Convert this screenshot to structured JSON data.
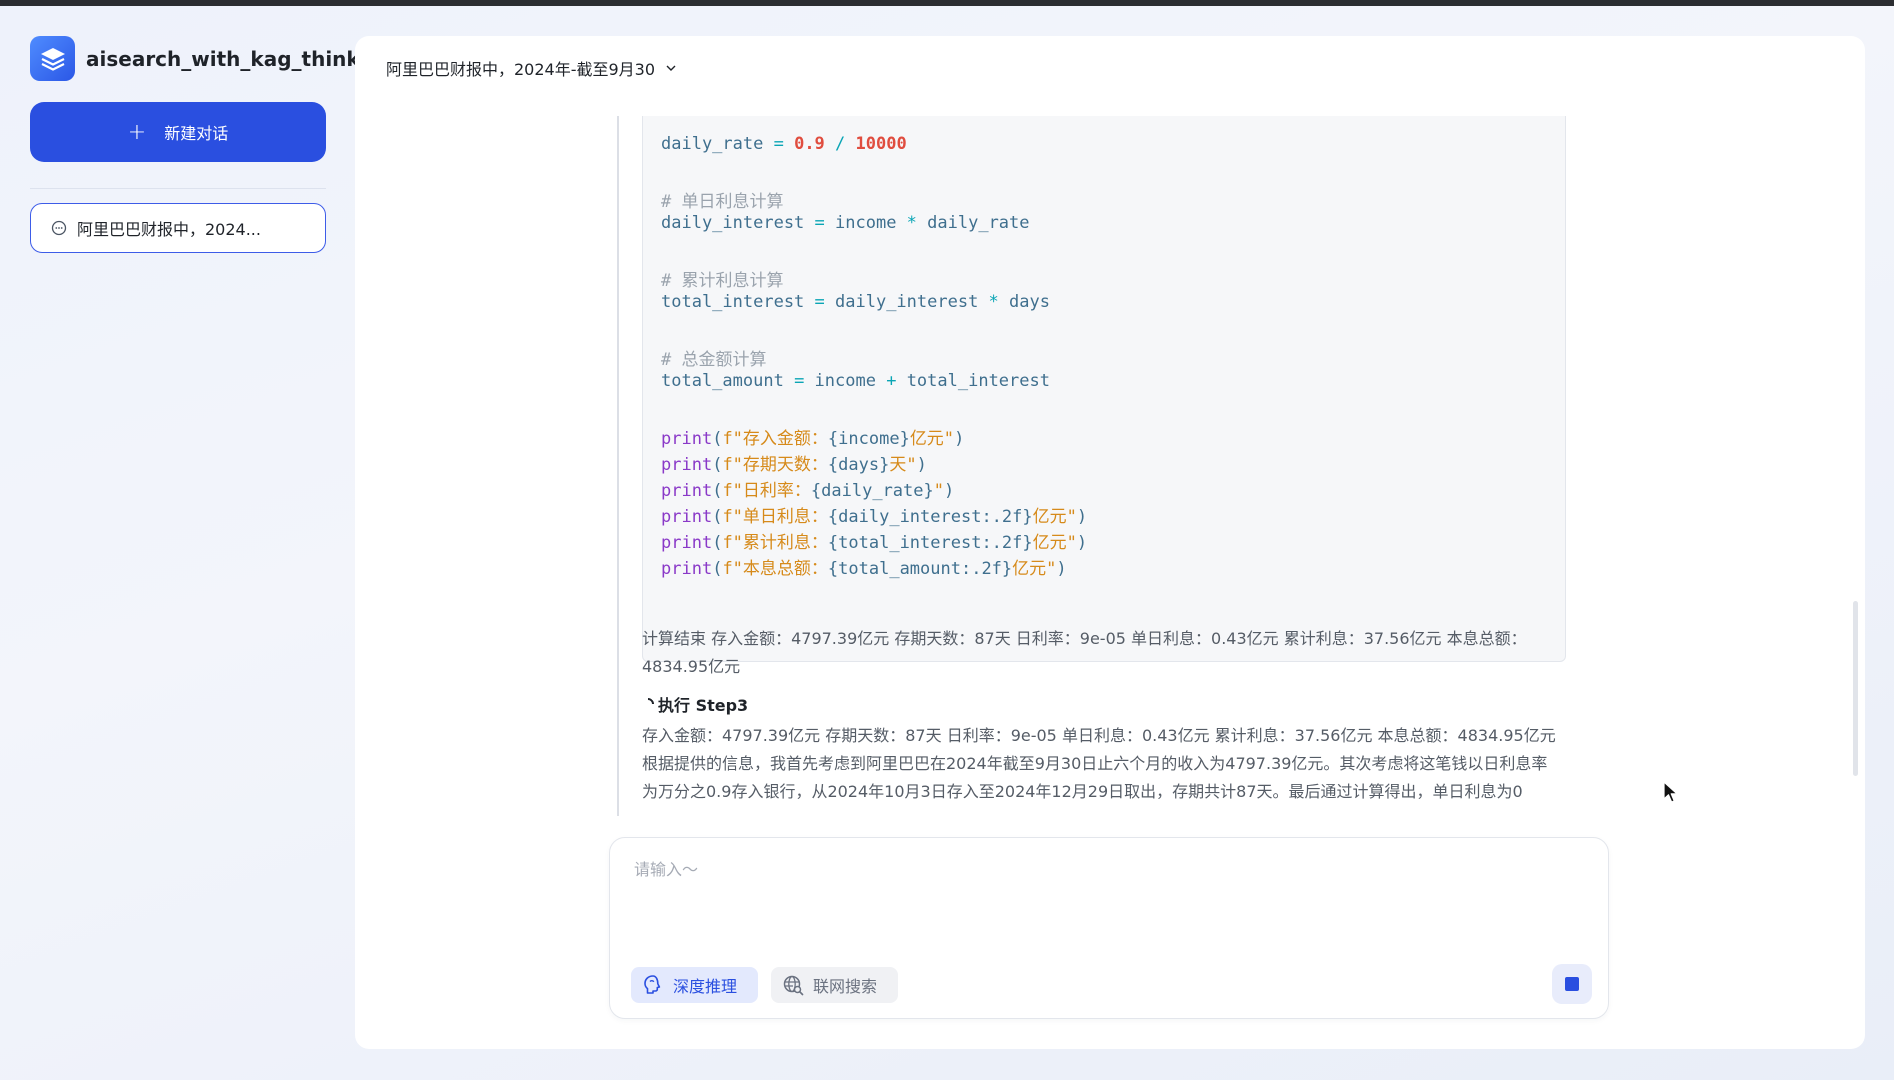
{
  "app": {
    "name": "aisearch_with_kag_thinker"
  },
  "sidebar": {
    "new_chat_label": "新建对话",
    "new_chat_plus": "+",
    "chats": [
      {
        "label": "阿里巴巴财报中，2024..."
      }
    ]
  },
  "header": {
    "title": "阿里巴巴财报中，2024年-截至9月30"
  },
  "code": {
    "line_daily_rate": {
      "var": "daily_rate",
      "op": " = ",
      "n1": "0.9",
      "slash": " / ",
      "n2": "10000"
    },
    "comment_single": "# 单日利息计算",
    "line_daily_interest": {
      "lhs": "daily_interest",
      "op": " = ",
      "a": "income",
      "mul": " * ",
      "b": "daily_rate"
    },
    "comment_total": "# 累计利息计算",
    "line_total_interest": {
      "lhs": "total_interest",
      "op": " = ",
      "a": "daily_interest",
      "mul": " * ",
      "b": "days"
    },
    "comment_amount": "# 总金额计算",
    "line_total_amount": {
      "lhs": "total_amount",
      "op": " = ",
      "a": "income",
      "plus": " + ",
      "b": "total_interest"
    },
    "prints": [
      {
        "fn": "print",
        "open": "(",
        "pre": "f\"存入金额：",
        "expr": "{income}",
        "post": "亿元\"",
        "close": ")"
      },
      {
        "fn": "print",
        "open": "(",
        "pre": "f\"存期天数：",
        "expr": "{days}",
        "post": "天\"",
        "close": ")"
      },
      {
        "fn": "print",
        "open": "(",
        "pre": "f\"日利率：",
        "expr": "{daily_rate}",
        "post": "\"",
        "close": ")"
      },
      {
        "fn": "print",
        "open": "(",
        "pre": "f\"单日利息：",
        "expr": "{daily_interest:.2f}",
        "post": "亿元\"",
        "close": ")"
      },
      {
        "fn": "print",
        "open": "(",
        "pre": "f\"累计利息：",
        "expr": "{total_interest:.2f}",
        "post": "亿元\"",
        "close": ")"
      },
      {
        "fn": "print",
        "open": "(",
        "pre": "f\"本息总额：",
        "expr": "{total_amount:.2f}",
        "post": "亿元\"",
        "close": ")"
      }
    ]
  },
  "result_text": "计算结束 存入金额：4797.39亿元 存期天数：87天 日利率：9e-05 单日利息：0.43亿元 累计利息：37.56亿元 本息总额：4834.95亿元",
  "step": {
    "title": "执行 Step3",
    "text": "存入金额：4797.39亿元 存期天数：87天 日利率：9e-05 单日利息：0.43亿元 累计利息：37.56亿元 本息总额：4834.95亿元 根据提供的信息，我首先考虑到阿里巴巴在2024年截至9月30日止六个月的收入为4797.39亿元。其次考虑将这笔钱以日利息率为万分之0.9存入银行，从2024年10月3日存入至2024年12月29日取出，存期共计87天。最后通过计算得出，单日利息为0"
  },
  "input": {
    "placeholder": "请输入～",
    "value": ""
  },
  "chips": {
    "deep_reasoning": "深度推理",
    "web_search": "联网搜索"
  },
  "colors": {
    "accent": "#2a4fe0",
    "comment": "#9aa3ad",
    "operator": "#0aa5b5",
    "number": "#e04d3f",
    "function": "#8a39c8",
    "string": "#d68a1a"
  },
  "icons": {
    "logo": "layers-icon",
    "chat": "chat-bubble-icon",
    "chevron": "chevron-down-icon",
    "deep": "brain-icon",
    "web": "globe-search-icon",
    "stop": "stop-icon"
  }
}
